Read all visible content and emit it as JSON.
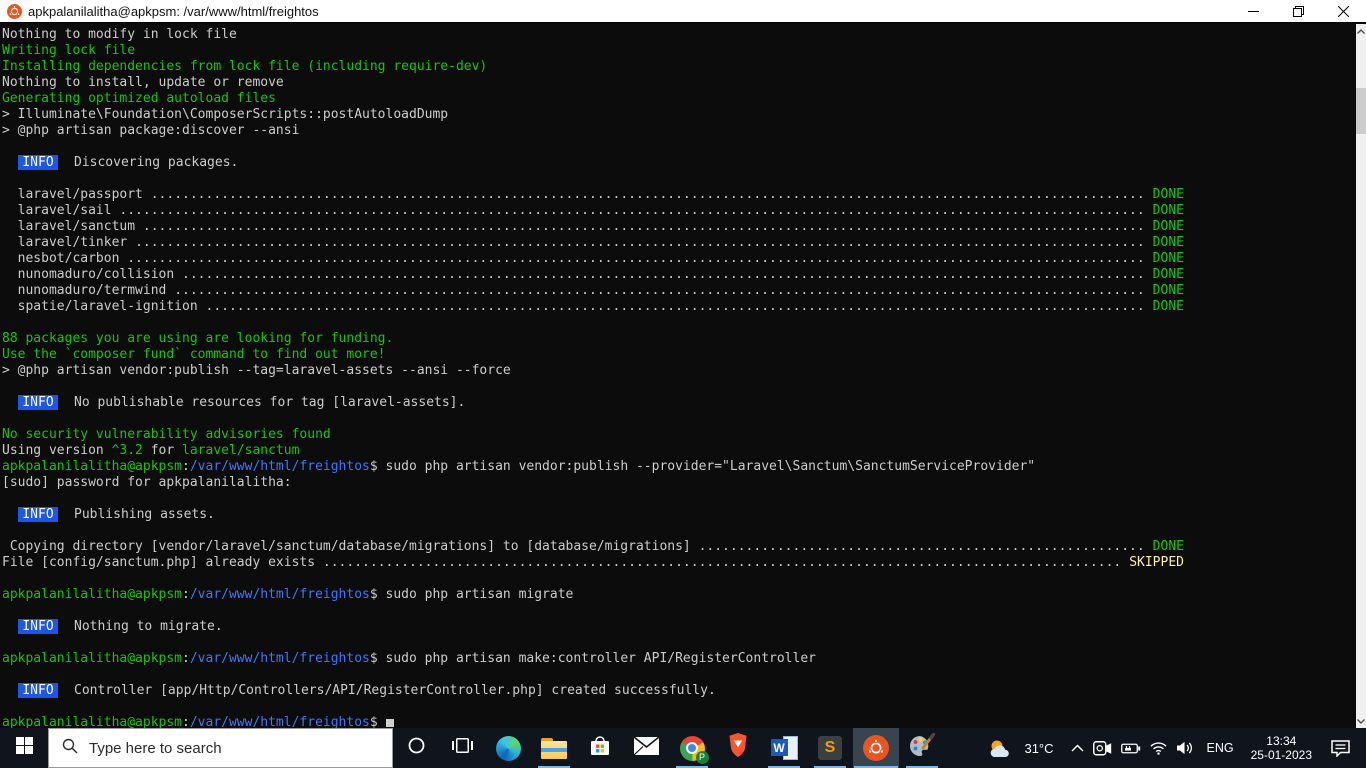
{
  "window": {
    "title": "apkpalanilalitha@apkpsm: /var/www/html/freightos",
    "controls": [
      "minimize",
      "restore",
      "close"
    ]
  },
  "colors": {
    "terminal_bg": "#0c0c0c",
    "terminal_fg": "#cccccc",
    "terminal_green": "#16c60c",
    "terminal_blue": "#3b78ff",
    "info_badge_bg": "#1c57e5",
    "skipped_yellow": "#f9f1a5",
    "taskbar_bg": "#10141d",
    "running_indicator": "#76b9ed",
    "ubuntu_orange": "#e95420"
  },
  "terminal": {
    "prompt": {
      "user": "apkpalanilalitha@apkpsm",
      "separator": ":",
      "path": "/var/www/html/freightos",
      "symbol": "$"
    },
    "lines": [
      [
        {
          "t": "Nothing to modify in lock file",
          "c": "fg"
        }
      ],
      [
        {
          "t": "Writing lock file",
          "c": "green"
        }
      ],
      [
        {
          "t": "Installing dependencies from lock file (including require-dev)",
          "c": "green"
        }
      ],
      [
        {
          "t": "Nothing to install, update or remove",
          "c": "fg"
        }
      ],
      [
        {
          "t": "Generating optimized autoload files",
          "c": "green"
        }
      ],
      [
        {
          "t": "> Illuminate\\Foundation\\ComposerScripts::postAutoloadDump",
          "c": "fg"
        }
      ],
      [
        {
          "t": "> @php artisan package:discover --ansi",
          "c": "fg"
        }
      ],
      [],
      [
        {
          "t": "  ",
          "c": "fg"
        },
        {
          "t": "INFO",
          "c": "badge"
        },
        {
          "t": "  Discovering packages.",
          "c": "fg"
        }
      ],
      [],
      [
        {
          "t": "  laravel/passport ",
          "c": "fg"
        },
        {
          "fill": true
        },
        {
          "t": " DONE",
          "c": "green"
        }
      ],
      [
        {
          "t": "  laravel/sail ",
          "c": "fg"
        },
        {
          "fill": true
        },
        {
          "t": " DONE",
          "c": "green"
        }
      ],
      [
        {
          "t": "  laravel/sanctum ",
          "c": "fg"
        },
        {
          "fill": true
        },
        {
          "t": " DONE",
          "c": "green"
        }
      ],
      [
        {
          "t": "  laravel/tinker ",
          "c": "fg"
        },
        {
          "fill": true
        },
        {
          "t": " DONE",
          "c": "green"
        }
      ],
      [
        {
          "t": "  nesbot/carbon ",
          "c": "fg"
        },
        {
          "fill": true
        },
        {
          "t": " DONE",
          "c": "green"
        }
      ],
      [
        {
          "t": "  nunomaduro/collision ",
          "c": "fg"
        },
        {
          "fill": true
        },
        {
          "t": " DONE",
          "c": "green"
        }
      ],
      [
        {
          "t": "  nunomaduro/termwind ",
          "c": "fg"
        },
        {
          "fill": true
        },
        {
          "t": " DONE",
          "c": "green"
        }
      ],
      [
        {
          "t": "  spatie/laravel-ignition ",
          "c": "fg"
        },
        {
          "fill": true
        },
        {
          "t": " DONE",
          "c": "green"
        }
      ],
      [],
      [
        {
          "t": "88 packages you are using are looking for funding.",
          "c": "green"
        }
      ],
      [
        {
          "t": "Use the `composer fund` command to find out more!",
          "c": "green"
        }
      ],
      [
        {
          "t": "> @php artisan vendor:publish --tag=laravel-assets --ansi --force",
          "c": "fg"
        }
      ],
      [],
      [
        {
          "t": "  ",
          "c": "fg"
        },
        {
          "t": "INFO",
          "c": "badge"
        },
        {
          "t": "  No publishable resources for tag [laravel-assets].",
          "c": "fg"
        }
      ],
      [],
      [
        {
          "t": "No security vulnerability advisories found",
          "c": "green"
        }
      ],
      [
        {
          "t": "Using version ",
          "c": "fg"
        },
        {
          "t": "^3.2",
          "c": "green"
        },
        {
          "t": " for ",
          "c": "fg"
        },
        {
          "t": "laravel/sanctum",
          "c": "green"
        }
      ],
      [
        {
          "prompt": true
        },
        {
          "t": " sudo php artisan vendor:publish --provider=\"Laravel\\Sanctum\\SanctumServiceProvider\"",
          "c": "fg"
        }
      ],
      [
        {
          "t": "[sudo] password for apkpalanilalitha:",
          "c": "fg"
        }
      ],
      [],
      [
        {
          "t": "  ",
          "c": "fg"
        },
        {
          "t": "INFO",
          "c": "badge"
        },
        {
          "t": "  Publishing assets.",
          "c": "fg"
        }
      ],
      [],
      [
        {
          "t": " Copying directory [vendor/laravel/sanctum/database/migrations] to [database/migrations] ",
          "c": "fg"
        },
        {
          "fill": true
        },
        {
          "t": " DONE",
          "c": "green"
        }
      ],
      [
        {
          "t": "File [config/sanctum.php] already exists ",
          "c": "fg"
        },
        {
          "fill": true
        },
        {
          "t": " SKIPPED",
          "c": "yellow"
        }
      ],
      [],
      [
        {
          "prompt": true
        },
        {
          "t": " sudo php artisan migrate",
          "c": "fg"
        }
      ],
      [],
      [
        {
          "t": "  ",
          "c": "fg"
        },
        {
          "t": "INFO",
          "c": "badge"
        },
        {
          "t": "  Nothing to migrate.",
          "c": "fg"
        }
      ],
      [],
      [
        {
          "prompt": true
        },
        {
          "t": " sudo php artisan make:controller API/RegisterController",
          "c": "fg"
        }
      ],
      [],
      [
        {
          "t": "  ",
          "c": "fg"
        },
        {
          "t": "INFO",
          "c": "badge"
        },
        {
          "t": "  Controller [app/Http/Controllers/API/RegisterController.php] created successfully.",
          "c": "fg"
        }
      ],
      [],
      [
        {
          "prompt": true
        },
        {
          "t": " ",
          "c": "fg"
        },
        {
          "cursor": true
        }
      ]
    ]
  },
  "taskbar": {
    "search_placeholder": "Type here to search",
    "apps": [
      {
        "name": "edge",
        "running": false
      },
      {
        "name": "file-explorer",
        "running": true
      },
      {
        "name": "microsoft-store",
        "running": false
      },
      {
        "name": "mail",
        "running": false
      },
      {
        "name": "chrome",
        "running": true,
        "badge": "P"
      },
      {
        "name": "brave",
        "running": false
      },
      {
        "name": "word",
        "running": true
      },
      {
        "name": "sublime-text",
        "running": true
      },
      {
        "name": "ubuntu-terminal",
        "running": true,
        "active": true
      },
      {
        "name": "paint",
        "running": true
      }
    ],
    "tray": {
      "temperature": "31°C",
      "language": "ENG",
      "time": "13:34",
      "date": "25-01-2023"
    }
  }
}
